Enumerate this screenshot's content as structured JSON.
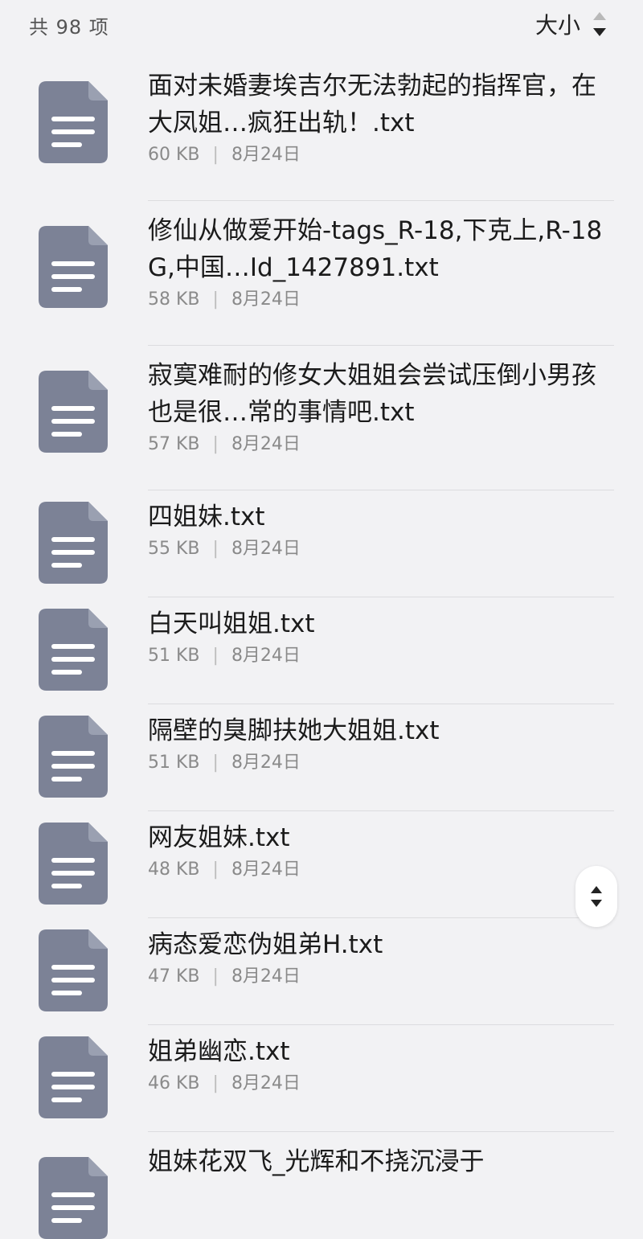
{
  "header": {
    "count_text": "共 98 项",
    "sort_label": "大小",
    "sort_icon": "sort-arrows-icon"
  },
  "files": [
    {
      "name": "面对未婚妻埃吉尔无法勃起的指挥官，在大凤姐…疯狂出轨！.txt",
      "size": "60 KB",
      "date": "8月24日"
    },
    {
      "name": "修仙从做爱开始-tags_R-18,下克上,R-18G,中国…Id_1427891.txt",
      "size": "58 KB",
      "date": "8月24日"
    },
    {
      "name": "寂寞难耐的修女大姐姐会尝试压倒小男孩也是很…常的事情吧.txt",
      "size": "57 KB",
      "date": "8月24日"
    },
    {
      "name": "四姐妹.txt",
      "size": "55 KB",
      "date": "8月24日"
    },
    {
      "name": "白天叫姐姐.txt",
      "size": "51 KB",
      "date": "8月24日"
    },
    {
      "name": "隔壁的臭脚扶她大姐姐.txt",
      "size": "51 KB",
      "date": "8月24日"
    },
    {
      "name": "网友姐妹.txt",
      "size": "48 KB",
      "date": "8月24日"
    },
    {
      "name": "病态爱恋伪姐弟H.txt",
      "size": "47 KB",
      "date": "8月24日"
    },
    {
      "name": "姐弟幽恋.txt",
      "size": "46 KB",
      "date": "8月24日"
    },
    {
      "name": "姐妹花双飞_光辉和不挠沉浸于",
      "size": "",
      "date": ""
    }
  ],
  "colors": {
    "icon_fill": "#7c8296",
    "background": "#f2f2f4"
  },
  "fab_icon": "scroll-handle-icon"
}
